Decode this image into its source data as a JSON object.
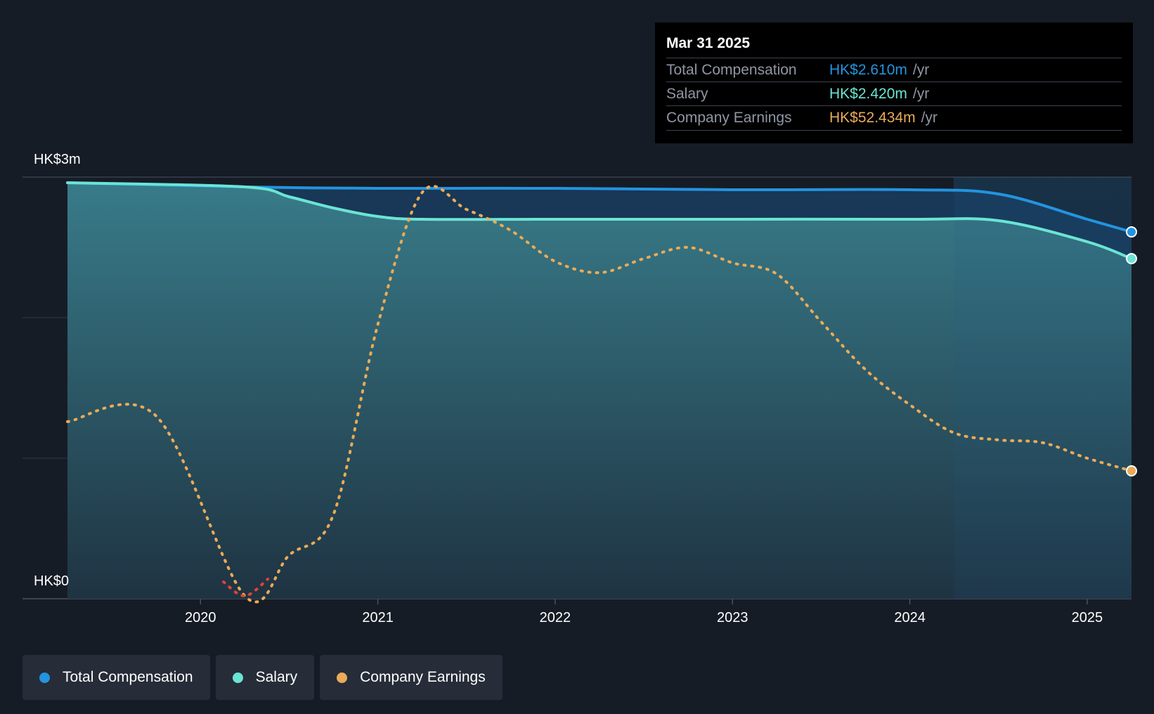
{
  "chart_data": {
    "type": "line",
    "title": "",
    "ylabels": {
      "top": "HK$3m",
      "bottom": "HK$0"
    },
    "ylim": [
      0,
      3
    ],
    "x_ticks": [
      "2020",
      "2021",
      "2022",
      "2023",
      "2024",
      "2025"
    ],
    "series": [
      {
        "name": "Total Compensation",
        "color": "#2394df",
        "points": [
          [
            2019.25,
            2.96
          ],
          [
            2020.25,
            2.93
          ],
          [
            2021.0,
            2.92
          ],
          [
            2022.0,
            2.92
          ],
          [
            2023.0,
            2.91
          ],
          [
            2024.0,
            2.91
          ],
          [
            2024.5,
            2.88
          ],
          [
            2025.0,
            2.7
          ],
          [
            2025.25,
            2.61
          ]
        ]
      },
      {
        "name": "Salary",
        "color": "#6be4d4",
        "points": [
          [
            2019.25,
            2.96
          ],
          [
            2020.25,
            2.93
          ],
          [
            2020.5,
            2.86
          ],
          [
            2020.75,
            2.78
          ],
          [
            2021.0,
            2.72
          ],
          [
            2021.25,
            2.7
          ],
          [
            2022.0,
            2.7
          ],
          [
            2023.0,
            2.7
          ],
          [
            2024.0,
            2.7
          ],
          [
            2024.5,
            2.69
          ],
          [
            2025.0,
            2.54
          ],
          [
            2025.25,
            2.42
          ]
        ]
      },
      {
        "name": "Company Earnings",
        "color": "#e9ab58",
        "dashed": true,
        "points": [
          [
            2019.25,
            1.26
          ],
          [
            2019.75,
            1.3
          ],
          [
            2020.25,
            0.02
          ],
          [
            2020.5,
            0.31
          ],
          [
            2020.75,
            0.6
          ],
          [
            2021.0,
            1.95
          ],
          [
            2021.25,
            2.89
          ],
          [
            2021.5,
            2.77
          ],
          [
            2021.75,
            2.62
          ],
          [
            2022.0,
            2.4
          ],
          [
            2022.25,
            2.32
          ],
          [
            2022.5,
            2.42
          ],
          [
            2022.75,
            2.5
          ],
          [
            2023.0,
            2.39
          ],
          [
            2023.25,
            2.31
          ],
          [
            2023.5,
            1.97
          ],
          [
            2023.75,
            1.63
          ],
          [
            2024.0,
            1.38
          ],
          [
            2024.25,
            1.18
          ],
          [
            2024.5,
            1.13
          ],
          [
            2024.75,
            1.11
          ],
          [
            2025.0,
            1.0
          ],
          [
            2025.25,
            0.91
          ]
        ]
      }
    ]
  },
  "tooltip": {
    "date": "Mar 31 2025",
    "rows": [
      {
        "label": "Total Compensation",
        "value": "HK$2.610m",
        "unit": "/yr",
        "color": "#2394df"
      },
      {
        "label": "Salary",
        "value": "HK$2.420m",
        "unit": "/yr",
        "color": "#6be4d4"
      },
      {
        "label": "Company Earnings",
        "value": "HK$52.434m",
        "unit": "/yr",
        "color": "#e9ab58"
      }
    ]
  },
  "legend": [
    {
      "label": "Total Compensation",
      "color": "#2394df"
    },
    {
      "label": "Salary",
      "color": "#6be4d4"
    },
    {
      "label": "Company Earnings",
      "color": "#e9ab58"
    }
  ]
}
